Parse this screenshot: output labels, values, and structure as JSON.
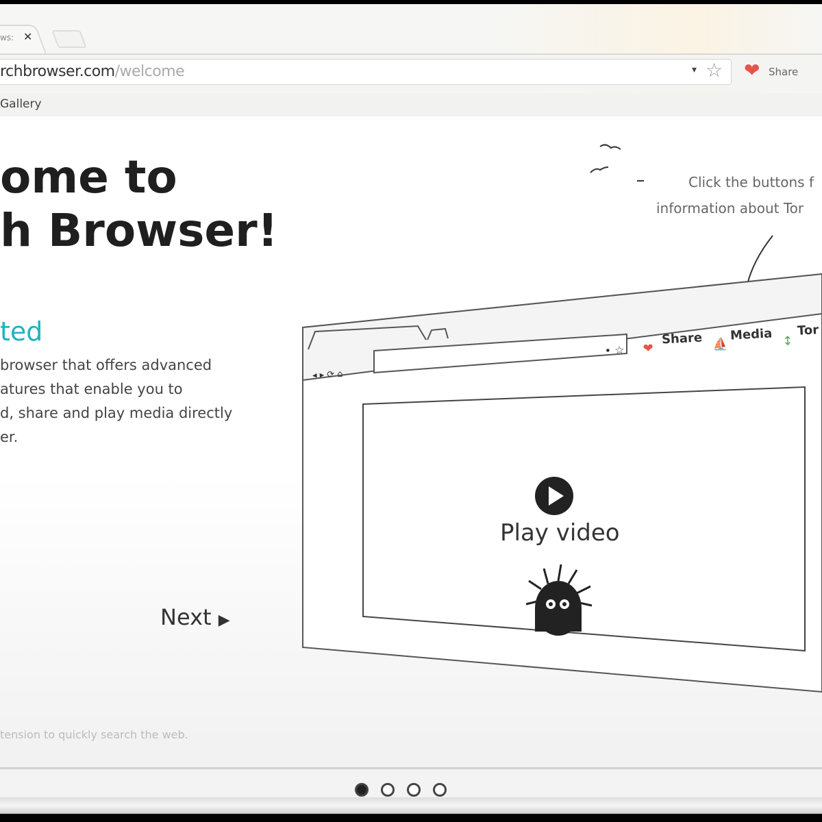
{
  "browser": {
    "tab_title": "ws:",
    "tab_close": "✕",
    "url_domain": "rchbrowser.com",
    "url_path": "/welcome",
    "share_label": "Share",
    "bookmark": "Gallery"
  },
  "welcome": {
    "title_line1": "ome to",
    "title_line2": "h Browser!",
    "subtitle": "ted",
    "paragraph": [
      "browser that offers advanced",
      "atures that enable you to",
      "d, share and play media directly",
      "er."
    ],
    "next_label": "Next",
    "footer_text": "tension to quickly search the web."
  },
  "illustration": {
    "hint_line1": "Click the buttons f",
    "hint_line2": "information about Tor",
    "share": "Share",
    "media": "Media",
    "torrent": "Tor",
    "play_label": "Play video"
  },
  "pager": {
    "pages": 4,
    "current": 1
  },
  "colors": {
    "accent": "#1fb3c0",
    "heart": "#e8534a"
  }
}
